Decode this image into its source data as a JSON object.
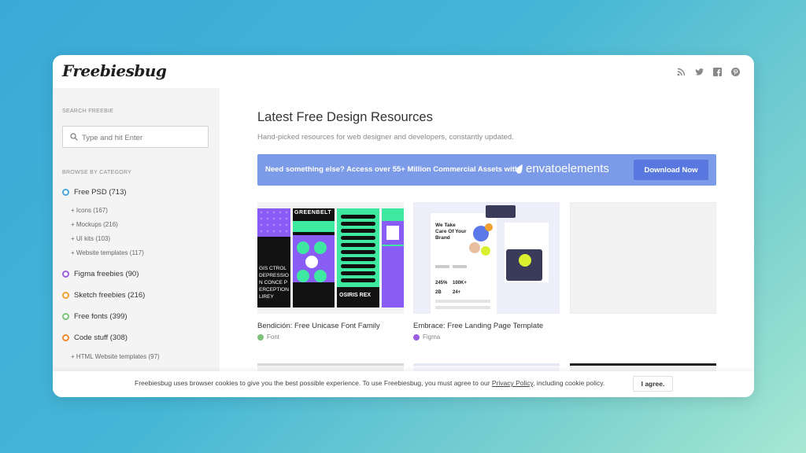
{
  "header": {
    "logo": "Freebiesbug",
    "social_icons": [
      "rss-icon",
      "twitter-icon",
      "facebook-icon",
      "pinterest-icon"
    ]
  },
  "sidebar": {
    "search_label": "SEARCH FREEBIE",
    "search_placeholder": "Type and hit Enter",
    "browse_label": "BROWSE BY CATEGORY",
    "categories": [
      {
        "label": "Free PSD (713)",
        "color": "#4aa8d8"
      },
      {
        "label": "Figma freebies (90)",
        "color": "#9b5fe0"
      },
      {
        "label": "Sketch freebies (216)",
        "color": "#f0a030"
      },
      {
        "label": "Free fonts (399)",
        "color": "#7cc27a"
      },
      {
        "label": "Code stuff (308)",
        "color": "#f08a30"
      }
    ],
    "psd_subs": [
      "+ Icons (167)",
      "+ Mockups (216)",
      "+ UI kits (103)",
      "+ Website templates (117)"
    ],
    "code_subs": [
      "+ HTML Website templates (97)"
    ]
  },
  "main": {
    "title": "Latest Free Design Resources",
    "subtitle": "Hand-picked resources for web designer and developers, constantly updated.",
    "banner": {
      "text": "Need something else? Access over 55+ Million Commercial Assets with",
      "brand_bold": "envato",
      "brand_light": "elements",
      "button": "Download Now",
      "color": "#7b9be8"
    },
    "cards": [
      {
        "title": "Bendición: Free Unicase Font Family",
        "tag": "Font",
        "tag_color": "#7cc27a"
      },
      {
        "title": "Embrace: Free Landing Page Template",
        "tag": "Figma",
        "tag_color": "#9b5fe0"
      }
    ],
    "thumb1": {
      "greenbelt": "GREENBELT",
      "osiris": "OSIRIS REX",
      "left_text": "GIS CTROL DEPRESSION CONCE PERCEPTION LIREY"
    },
    "thumb2": {
      "headline": "We Take Care Of Your Brand",
      "stat1": "245%",
      "stat2": "100K+",
      "stat3": "2B",
      "stat4": "24+"
    }
  },
  "cookie": {
    "text_before": "Freebiesbug uses browser cookies to give you the best possible experience. To use Freebiesbug, you must agree to our",
    "link": "Privacy Policy",
    "text_after": ", including cookie policy.",
    "button": "I agree."
  }
}
